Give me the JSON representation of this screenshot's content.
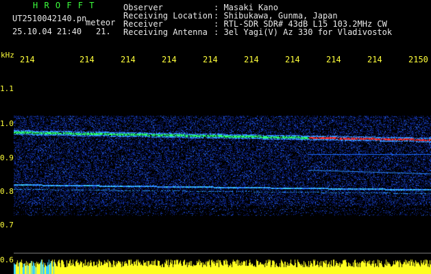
{
  "header": {
    "title": "H R O F F T",
    "filename": "UT2510042140.pn",
    "label_meteor": "meteor",
    "datetime": "25.10.04 21:40",
    "frame": "21.",
    "info": [
      {
        "key": "Observer",
        "value": ": Masaki Kano"
      },
      {
        "key": "Receiving Location",
        "value": ": Shibukawa, Gunma, Japan"
      },
      {
        "key": "Receiver",
        "value": ": RTL-SDR SDR# 43dB L15 103.2MHz CW"
      },
      {
        "key": "Receiving Antenna",
        "value": ": 3el Yagi(V) Az 330 for Vladivostok"
      }
    ]
  },
  "axis": {
    "unit": "kHz",
    "x_ticks": [
      "214",
      "214",
      "214",
      "214",
      "214",
      "214",
      "214",
      "214",
      "214",
      "2150"
    ],
    "y_ticks": [
      "1.1",
      "1.0",
      "0.9",
      "0.8",
      "0.7",
      "0.6"
    ]
  },
  "colors": {
    "header_green": "#3cff3c",
    "label_yellow": "#ffff3a",
    "text_white": "#e8e8e8"
  }
}
